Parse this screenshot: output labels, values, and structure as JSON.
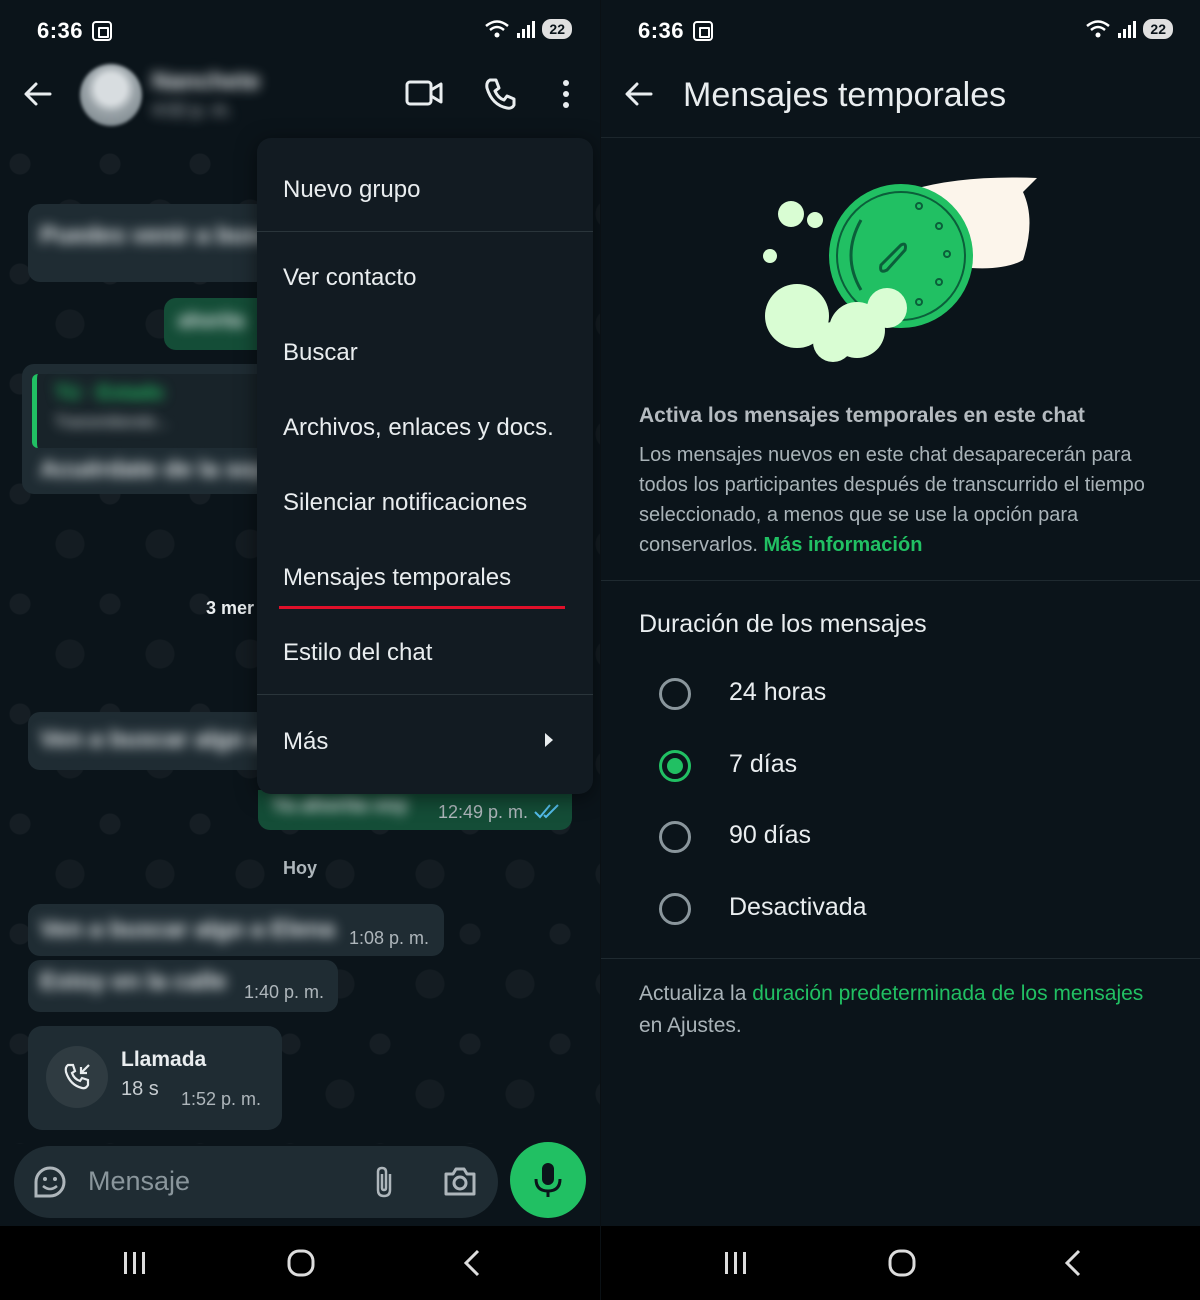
{
  "status_bar": {
    "time": "6:36",
    "battery": "22"
  },
  "left": {
    "contact": {
      "name": "Nanchete",
      "subtitle": "4:02 p. m."
    },
    "messages": [
      {
        "text": "Puedes venir a buscar",
        "dir": "in"
      },
      {
        "text": "ahorita",
        "dir": "out"
      },
      {
        "quote_title": "Tú · Estado",
        "quote_sub": "Transmitiendo...",
        "text": "Acuérdate de la sopa",
        "dir": "in"
      },
      {
        "text": "Ven a buscar algo a",
        "dir": "in"
      },
      {
        "text": "Ya ahorita voy",
        "time": "12:49 p. m.",
        "dir": "out"
      },
      {
        "text": "Ven a buscar algo a Elena",
        "time": "1:08 p. m.",
        "dir": "in"
      },
      {
        "text": "Estoy en la calle",
        "time": "1:40 p. m.",
        "dir": "in"
      }
    ],
    "day_chip_prev": "3 mer",
    "day_chip_today": "Hoy",
    "call": {
      "title": "Llamada",
      "duration": "18 s",
      "time": "1:52 p. m."
    },
    "input_placeholder": "Mensaje",
    "menu": {
      "items": [
        "Nuevo grupo",
        "Ver contacto",
        "Buscar",
        "Archivos, enlaces y docs.",
        "Silenciar notificaciones",
        "Mensajes temporales",
        "Estilo del chat",
        "Más"
      ]
    }
  },
  "right": {
    "title": "Mensajes temporales",
    "info_title": "Activa los mensajes temporales en este chat",
    "info_body": "Los mensajes nuevos en este chat desaparecerán para todos los participantes después de transcurrido el tiempo seleccionado, a menos que se use la opción para conservarlos.",
    "info_link": "Más información",
    "duration_title": "Duración de los mensajes",
    "options": [
      {
        "label": "24 horas",
        "selected": false
      },
      {
        "label": "7 días",
        "selected": true
      },
      {
        "label": "90 días",
        "selected": false
      },
      {
        "label": "Desactivada",
        "selected": false
      }
    ],
    "footer_pre": "Actualiza la ",
    "footer_link": "duración predeterminada de los mensajes",
    "footer_post": " en Ajustes."
  },
  "colors": {
    "accent": "#21c063",
    "background": "#0b141a",
    "menu_bg": "#121b22",
    "highlight_underline": "#e0102a"
  },
  "icons": [
    "back-arrow-icon",
    "video-call-icon",
    "phone-icon",
    "more-vert-icon",
    "sticker-icon",
    "attach-icon",
    "camera-icon",
    "mic-icon",
    "incoming-call-icon",
    "chevron-right-icon",
    "recents-nav-icon",
    "home-nav-icon",
    "back-nav-icon",
    "wifi-icon",
    "signal-icon",
    "screenshot-icon"
  ]
}
